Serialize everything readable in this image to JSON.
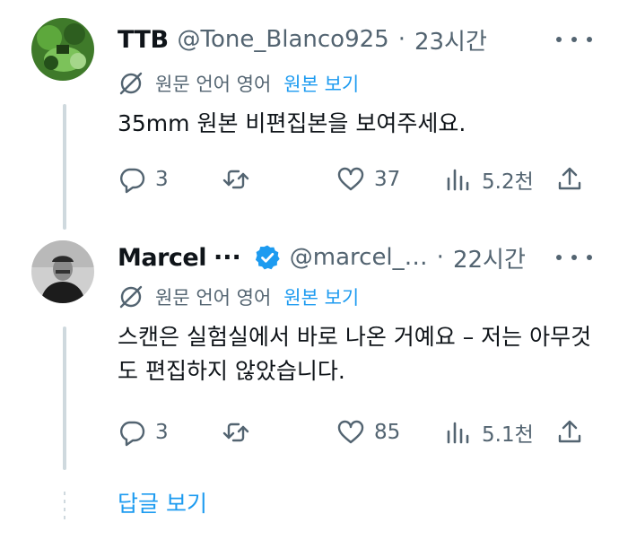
{
  "colors": {
    "accent": "#1d9bf0",
    "secondary_text": "#536471",
    "primary_text": "#0f1419",
    "divider": "#cfd9de"
  },
  "tweets": [
    {
      "name": "TTB",
      "name_suffix": "",
      "verified": false,
      "handle": "@Tone_Blanco925",
      "separator": "·",
      "time": "23시간",
      "lang_note": "원문 언어 영어",
      "show_original": "원본 보기",
      "text": "35mm 원본 비편집본을 보여주세요.",
      "replies": "3",
      "retweets": "",
      "likes": "37",
      "views": "5.2천"
    },
    {
      "name": "Marcel",
      "name_suffix": "···",
      "verified": true,
      "handle": "@marcel_…",
      "separator": "·",
      "time": "22시간",
      "lang_note": "원문 언어 영어",
      "show_original": "원본 보기",
      "text": "스캔은 실험실에서 바로 나온 거예요 – 저는 아무것도 편집하지 않았습니다.",
      "replies": "3",
      "retweets": "",
      "likes": "85",
      "views": "5.1천"
    }
  ],
  "show_replies": "답글 보기",
  "icons": [
    "reply-icon",
    "retweet-icon",
    "like-icon",
    "views-icon",
    "share-icon",
    "translate-icon",
    "more-icon",
    "verified-icon"
  ]
}
